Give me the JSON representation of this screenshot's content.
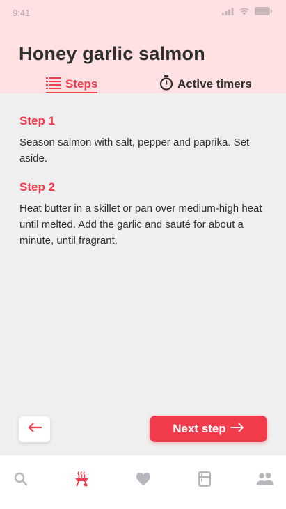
{
  "status_bar": {
    "time": "9:41"
  },
  "recipe": {
    "title": "Honey garlic salmon"
  },
  "tabs": [
    {
      "label": "Steps",
      "icon": "list-icon",
      "active": true
    },
    {
      "label": "Active timers",
      "icon": "stopwatch-icon",
      "active": false
    }
  ],
  "steps": [
    {
      "title": "Step 1",
      "text": "Season salmon with salt, pepper and paprika. Set aside."
    },
    {
      "title": "Step 2",
      "text": "Heat butter in a skillet or pan over medium-high heat until melted. Add the garlic and sauté for about a minute, until fragrant."
    }
  ],
  "actions": {
    "back_icon": "arrow-left-icon",
    "next_label": "Next step"
  },
  "bottom_nav": [
    {
      "icon": "search-icon",
      "active": false
    },
    {
      "icon": "cooking-icon",
      "active": true
    },
    {
      "icon": "heart-icon",
      "active": false
    },
    {
      "icon": "fridge-icon",
      "active": false
    },
    {
      "icon": "people-icon",
      "active": false
    }
  ],
  "colors": {
    "accent": "#f23c4c",
    "header_bg": "#ffe1e3",
    "page_bg": "#f0eff0",
    "inactive_icon": "#b7b7bd"
  }
}
